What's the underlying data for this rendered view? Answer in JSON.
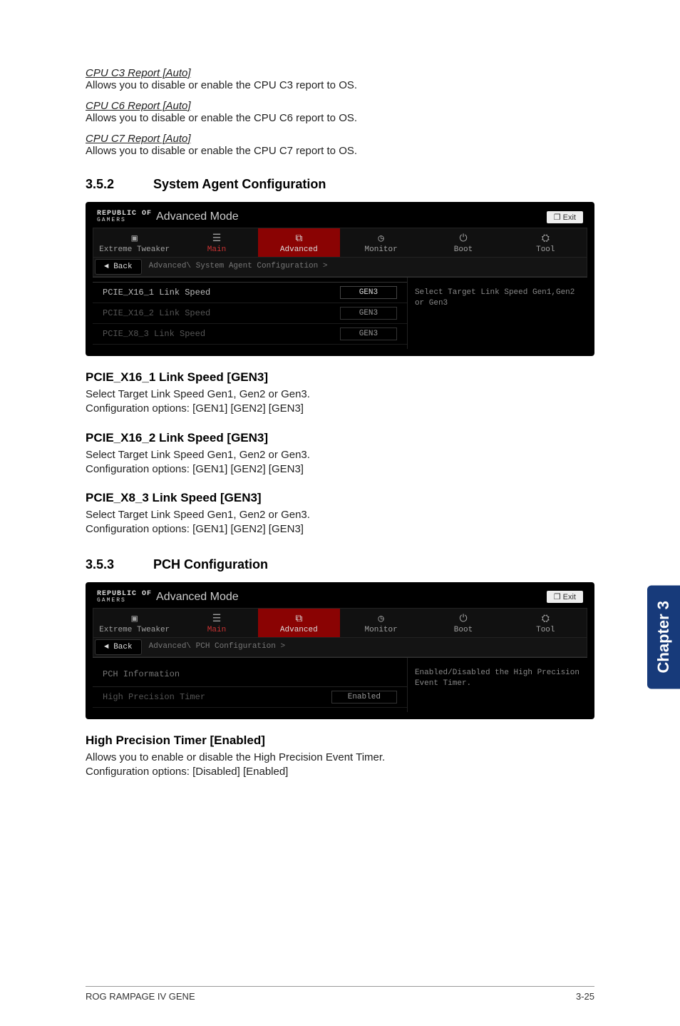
{
  "cpu_reports": [
    {
      "title": "CPU C3 Report [Auto]",
      "desc": "Allows you to disable or enable the CPU C3 report to OS."
    },
    {
      "title": "CPU C6 Report [Auto]",
      "desc": "Allows you to disable or enable the CPU C6 report to OS."
    },
    {
      "title": "CPU C7 Report [Auto]",
      "desc": "Allows you to disable or enable the CPU C7 report to OS."
    }
  ],
  "section_352": {
    "num": "3.5.2",
    "title": "System Agent Configuration"
  },
  "section_353": {
    "num": "3.5.3",
    "title": "PCH Configuration"
  },
  "bios_common": {
    "logo_line1": "REPUBLIC OF",
    "logo_line2": "GAMERS",
    "mode": "Advanced Mode",
    "exit": "Exit",
    "back": "Back",
    "tabs": {
      "tweaker": "Extreme Tweaker",
      "main": "Main",
      "advanced": "Advanced",
      "monitor": "Monitor",
      "boot": "Boot",
      "tool": "Tool"
    }
  },
  "bios_sac": {
    "crumb": "Advanced\\ System Agent Configuration >",
    "rows": [
      {
        "label": "PCIE_X16_1 Link Speed",
        "value": "GEN3",
        "primary": true
      },
      {
        "label": "PCIE_X16_2 Link Speed",
        "value": "GEN3",
        "primary": false
      },
      {
        "label": "PCIE_X8_3 Link Speed",
        "value": "GEN3",
        "primary": false
      }
    ],
    "help": "Select Target Link Speed Gen1,Gen2 or Gen3"
  },
  "pcie_settings": [
    {
      "title": "PCIE_X16_1 Link Speed [GEN3]",
      "line1": "Select Target Link Speed Gen1, Gen2 or Gen3.",
      "line2": "Configuration options: [GEN1] [GEN2] [GEN3]"
    },
    {
      "title": "PCIE_X16_2 Link Speed [GEN3]",
      "line1": "Select Target Link Speed Gen1, Gen2 or Gen3.",
      "line2": "Configuration options: [GEN1] [GEN2] [GEN3]"
    },
    {
      "title": "PCIE_X8_3 Link Speed [GEN3]",
      "line1": "Select Target Link Speed Gen1, Gen2 or Gen3.",
      "line2": "Configuration options: [GEN1] [GEN2] [GEN3]"
    }
  ],
  "bios_pch": {
    "crumb": "Advanced\\ PCH Configuration >",
    "info_label": "PCH Information",
    "row": {
      "label": "High Precision Timer",
      "value": "Enabled"
    },
    "help": "Enabled/Disabled the High Precision Event Timer."
  },
  "hpt": {
    "title": "High Precision Timer [Enabled]",
    "line1": "Allows you to enable or disable the High Precision Event Timer.",
    "line2": "Configuration options: [Disabled] [Enabled]"
  },
  "side_tab": "Chapter 3",
  "footer": {
    "left": "ROG RAMPAGE IV GENE",
    "right": "3-25"
  }
}
